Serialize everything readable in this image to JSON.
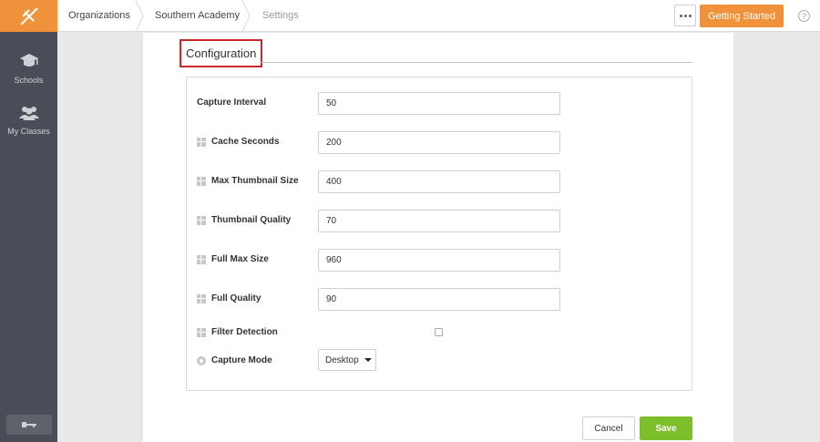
{
  "sidebar": {
    "items": [
      {
        "label": "Schools",
        "icon": "graduation-cap-icon"
      },
      {
        "label": "My Classes",
        "icon": "users-icon"
      }
    ],
    "bottom_icon": "key-icon"
  },
  "topbar": {
    "breadcrumbs": [
      "Organizations",
      "Southern Academy",
      "Settings"
    ],
    "getting_started_label": "Getting Started",
    "help_glyph": "?"
  },
  "config": {
    "title": "Configuration",
    "fields": [
      {
        "label": "Capture Interval",
        "value": "50",
        "icon": null
      },
      {
        "label": "Cache Seconds",
        "value": "200",
        "icon": "windows-icon"
      },
      {
        "label": "Max Thumbnail Size",
        "value": "400",
        "icon": "windows-icon"
      },
      {
        "label": "Thumbnail Quality",
        "value": "70",
        "icon": "windows-icon"
      },
      {
        "label": "Full Max Size",
        "value": "960",
        "icon": "windows-icon"
      },
      {
        "label": "Full Quality",
        "value": "90",
        "icon": "windows-icon"
      }
    ],
    "filter_detection": {
      "label": "Filter Detection",
      "checked": false,
      "icon": "windows-icon"
    },
    "capture_mode": {
      "label": "Capture Mode",
      "value": "Desktop",
      "icon": "chrome-icon"
    }
  },
  "actions": {
    "cancel_label": "Cancel",
    "save_label": "Save"
  },
  "colors": {
    "accent": "#f0923b",
    "save": "#7cbf2a",
    "sidebar": "#4a4d57",
    "highlight": "#c9282d"
  }
}
